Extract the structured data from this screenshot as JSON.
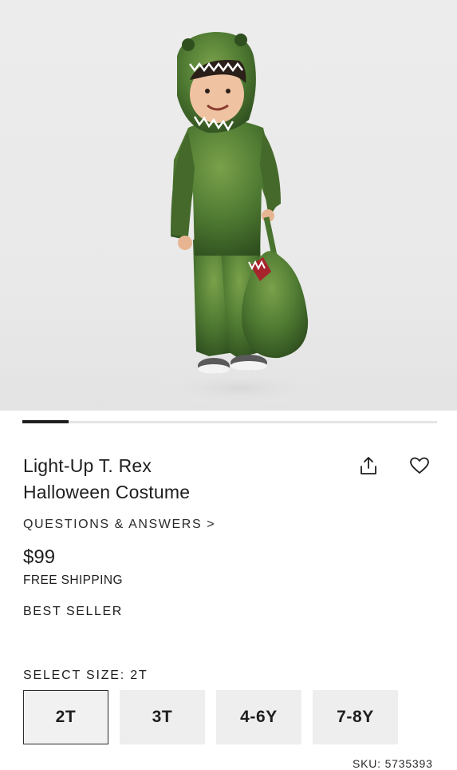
{
  "product": {
    "image_alt": "Toddler wearing green light-up T. Rex costume holding dinosaur treat bag",
    "title_line1": "Light-Up T. Rex",
    "title_line2": "Halloween Costume",
    "questions_link": "QUESTIONS & ANSWERS >",
    "price": "$99",
    "shipping": "FREE SHIPPING",
    "badge": "BEST SELLER",
    "sku": "SKU: 5735393"
  },
  "carousel": {
    "active_index": 0
  },
  "actions": {
    "share_icon": "share-icon",
    "favorite_icon": "heart-icon"
  },
  "size_selector": {
    "label": "SELECT SIZE: 2T",
    "selected": "2T",
    "options": [
      "2T",
      "3T",
      "4-6Y",
      "7-8Y"
    ]
  },
  "colors": {
    "text": "#1e1e1e",
    "costume_green": "#4f7a32",
    "background": "#ffffff"
  }
}
